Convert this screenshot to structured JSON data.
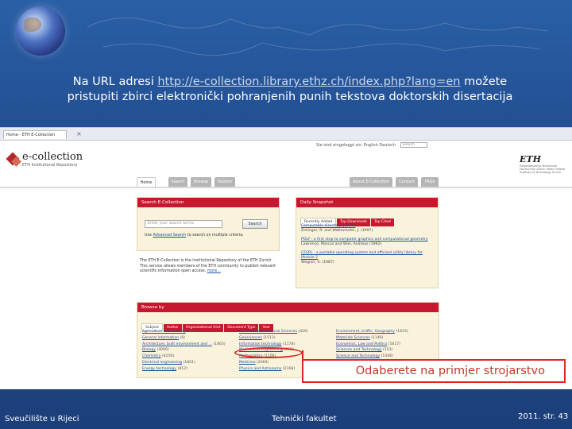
{
  "caption": {
    "prefix": "Na URL adresi ",
    "url": "http://e-collection.library.ethz.ch/index.php?lang=en",
    "suffix": " možete",
    "line2": "pristupiti zbirci elektronički pohranjenih punih tekstova doktorskih disertacija"
  },
  "browser": {
    "tab_title": "Home - ETH E-Collection",
    "top_links": "Sie sind eingeloggt als:  English  Deutsch",
    "top_search": "Search"
  },
  "site": {
    "logo_title": "e-collection",
    "logo_subtitle": "ETH Institutional Repository",
    "eth_name": "ETH",
    "eth_sub": "Eidgenössische Technische Hochschule Zürich Swiss Federal Institute of Technology Zurich"
  },
  "nav": {
    "items": [
      "Home",
      "Search",
      "Browse",
      "Publish",
      "About E-Collection",
      "Contact",
      "FAQs"
    ]
  },
  "search_panel": {
    "title": "Search E-Collection",
    "placeholder": "Enter your search terms",
    "button": "Search",
    "use_prefix": "Use ",
    "advanced": "Advanced Search",
    "use_suffix": " to search on multiple criteria."
  },
  "about": {
    "text": "The ETH E-Collection is the Institutional Repository of the ETH Zurich. This service allows members of the ETH community to publish relevant scientific information open access.",
    "more": "more..."
  },
  "snapshot": {
    "title": "Daily Snapshot",
    "tabs": [
      "Recently Added",
      "Top Downloads",
      "Top Cited"
    ],
    "items": [
      {
        "title": "Computable directory queries",
        "authors": "Zeilinger, R. and Wattenhofer, J. (1997)"
      },
      {
        "title": "POLY - a first step to computer graphics and computational geometry",
        "authors": "Lawrence, Marcus and Wiel, Andreas (1992)"
      },
      {
        "title": "CESPL - a portable operating system and efficient utility library for Module 2",
        "authors": "Wegner, S. (1987)"
      }
    ]
  },
  "browse": {
    "title": "Browse by",
    "tabs": [
      "Subject",
      "Author",
      "Organizational Unit",
      "Document Type",
      "Year"
    ],
    "col1": [
      {
        "label": "Agriculture and forestry",
        "count": "(1411)"
      },
      {
        "label": "General information",
        "count": "(8)"
      },
      {
        "label": "Architecture, built environment and ...",
        "count": "(1863)"
      },
      {
        "label": "Biology",
        "count": "(4006)"
      },
      {
        "label": "Chemistry",
        "count": "(4256)"
      },
      {
        "label": "Electrical engineering",
        "count": "(1601)"
      },
      {
        "label": "Energy technology",
        "count": "(812)"
      }
    ],
    "col2": [
      {
        "label": "Humanities and Social Sciences",
        "count": "(426)"
      },
      {
        "label": "Geosciences",
        "count": "(1513)"
      },
      {
        "label": "Information technology",
        "count": "(1178)"
      },
      {
        "label": "Mechanical Engineering",
        "count": "(652)"
      },
      {
        "label": "Mathematics",
        "count": "(1106)"
      },
      {
        "label": "Medicine",
        "count": "(2069)"
      },
      {
        "label": "Physics and Astronomy",
        "count": "(2168)"
      }
    ],
    "col3": [
      {
        "label": "Environment, traffic, Geography",
        "count": "(1619)"
      },
      {
        "label": "Materials Sciences",
        "count": "(1146)"
      },
      {
        "label": "Economics, Law and Politics",
        "count": "(1617)"
      },
      {
        "label": "Sciences and Technology",
        "count": "(153)"
      },
      {
        "label": "Science and Technology",
        "count": "(1448)"
      }
    ]
  },
  "callout": "Odaberete na primjer strojarstvo",
  "footer": {
    "left": "Sveučilište u Rijeci",
    "middle": "Tehnički fakultet",
    "right": "2011.  str. 43"
  },
  "colors": {
    "background": "#1f4788",
    "accent_red": "#c8182f",
    "callout_border": "#e0271d"
  }
}
